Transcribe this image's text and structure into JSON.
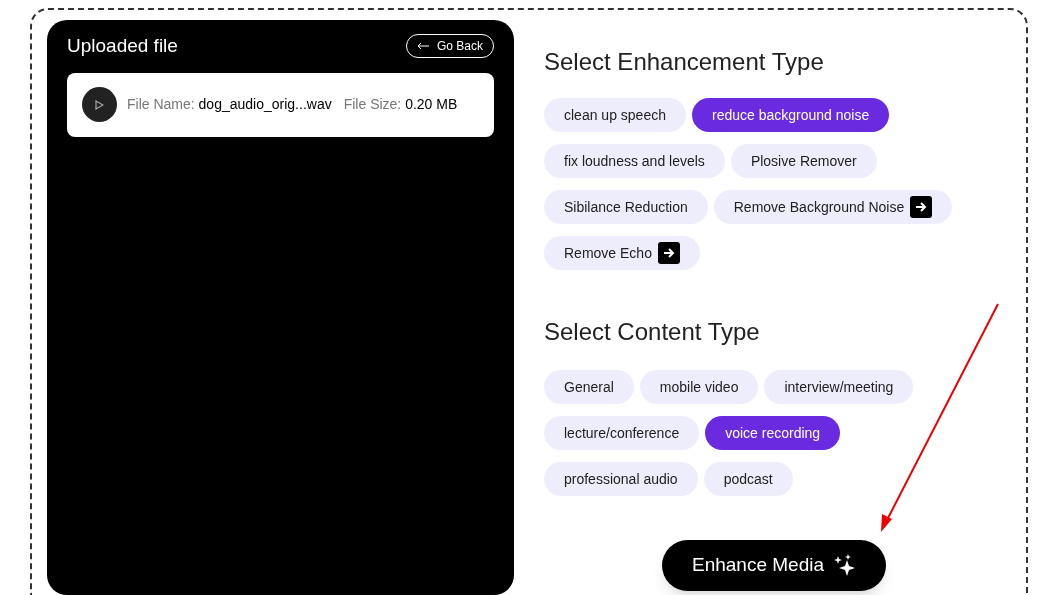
{
  "upload_panel": {
    "title": "Uploaded file",
    "back_button": "Go Back",
    "file": {
      "name_label": "File Name:",
      "name": "dog_audio_orig...wav",
      "size_label": "File Size:",
      "size": "0.20 MB"
    }
  },
  "enhancement_type": {
    "heading": "Select Enhancement Type",
    "options": [
      {
        "label": "clean up speech",
        "kind": "option",
        "selected": false
      },
      {
        "label": "reduce background noise",
        "kind": "option",
        "selected": true
      },
      {
        "label": "fix loudness and levels",
        "kind": "option",
        "selected": false
      },
      {
        "label": "Plosive Remover",
        "kind": "option",
        "selected": false
      },
      {
        "label": "Sibilance Reduction",
        "kind": "option",
        "selected": false
      },
      {
        "label": "Remove Background Noise",
        "kind": "link",
        "selected": false
      },
      {
        "label": "Remove Echo",
        "kind": "link",
        "selected": false
      }
    ]
  },
  "content_type": {
    "heading": "Select Content Type",
    "options": [
      {
        "label": "General",
        "selected": false
      },
      {
        "label": "mobile video",
        "selected": false
      },
      {
        "label": "interview/meeting",
        "selected": false
      },
      {
        "label": "lecture/conference",
        "selected": false
      },
      {
        "label": "voice recording",
        "selected": true
      },
      {
        "label": "professional audio",
        "selected": false
      },
      {
        "label": "podcast",
        "selected": false
      }
    ]
  },
  "enhance_button": "Enhance Media"
}
